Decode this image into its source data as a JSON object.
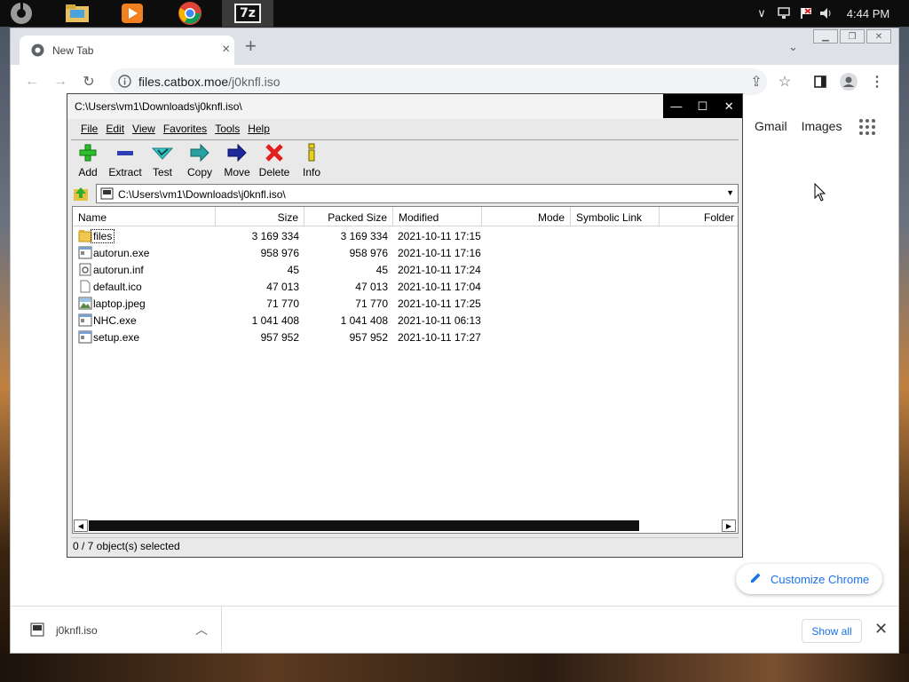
{
  "taskbar": {
    "apps": [
      {
        "name": "start-icon"
      },
      {
        "name": "file-explorer-icon"
      },
      {
        "name": "media-player-icon"
      },
      {
        "name": "chrome-icon"
      },
      {
        "name": "sevenzip-icon",
        "label": "7z"
      }
    ],
    "clock": "4:44 PM"
  },
  "chrome": {
    "tab_title": "New Tab",
    "url_host": "files.catbox.moe",
    "url_path": "/j0knfl.iso",
    "ntp_links": [
      "Gmail",
      "Images"
    ],
    "customize_label": "Customize Chrome",
    "download": {
      "file": "j0knfl.iso",
      "show_all": "Show all"
    }
  },
  "sevenzip": {
    "title": "C:\\Users\\vm1\\Downloads\\j0knfl.iso\\",
    "menu": [
      "File",
      "Edit",
      "View",
      "Favorites",
      "Tools",
      "Help"
    ],
    "toolbar": [
      "Add",
      "Extract",
      "Test",
      "Copy",
      "Move",
      "Delete",
      "Info"
    ],
    "address": "C:\\Users\\vm1\\Downloads\\j0knfl.iso\\",
    "columns": [
      "Name",
      "Size",
      "Packed Size",
      "Modified",
      "Mode",
      "Symbolic Link",
      "Folder"
    ],
    "rows": [
      {
        "name": "files",
        "size": "3 169 334",
        "packed": "3 169 334",
        "modified": "2021-10-11 17:15",
        "kind": "folder"
      },
      {
        "name": "autorun.exe",
        "size": "958 976",
        "packed": "958 976",
        "modified": "2021-10-11 17:16",
        "kind": "exe"
      },
      {
        "name": "autorun.inf",
        "size": "45",
        "packed": "45",
        "modified": "2021-10-11 17:24",
        "kind": "inf"
      },
      {
        "name": "default.ico",
        "size": "47 013",
        "packed": "47 013",
        "modified": "2021-10-11 17:04",
        "kind": "file"
      },
      {
        "name": "laptop.jpeg",
        "size": "71 770",
        "packed": "71 770",
        "modified": "2021-10-11 17:25",
        "kind": "image"
      },
      {
        "name": "NHC.exe",
        "size": "1 041 408",
        "packed": "1 041 408",
        "modified": "2021-10-11 06:13",
        "kind": "exe"
      },
      {
        "name": "setup.exe",
        "size": "957 952",
        "packed": "957 952",
        "modified": "2021-10-11 17:27",
        "kind": "exe"
      }
    ],
    "status": "0 / 7 object(s) selected"
  }
}
